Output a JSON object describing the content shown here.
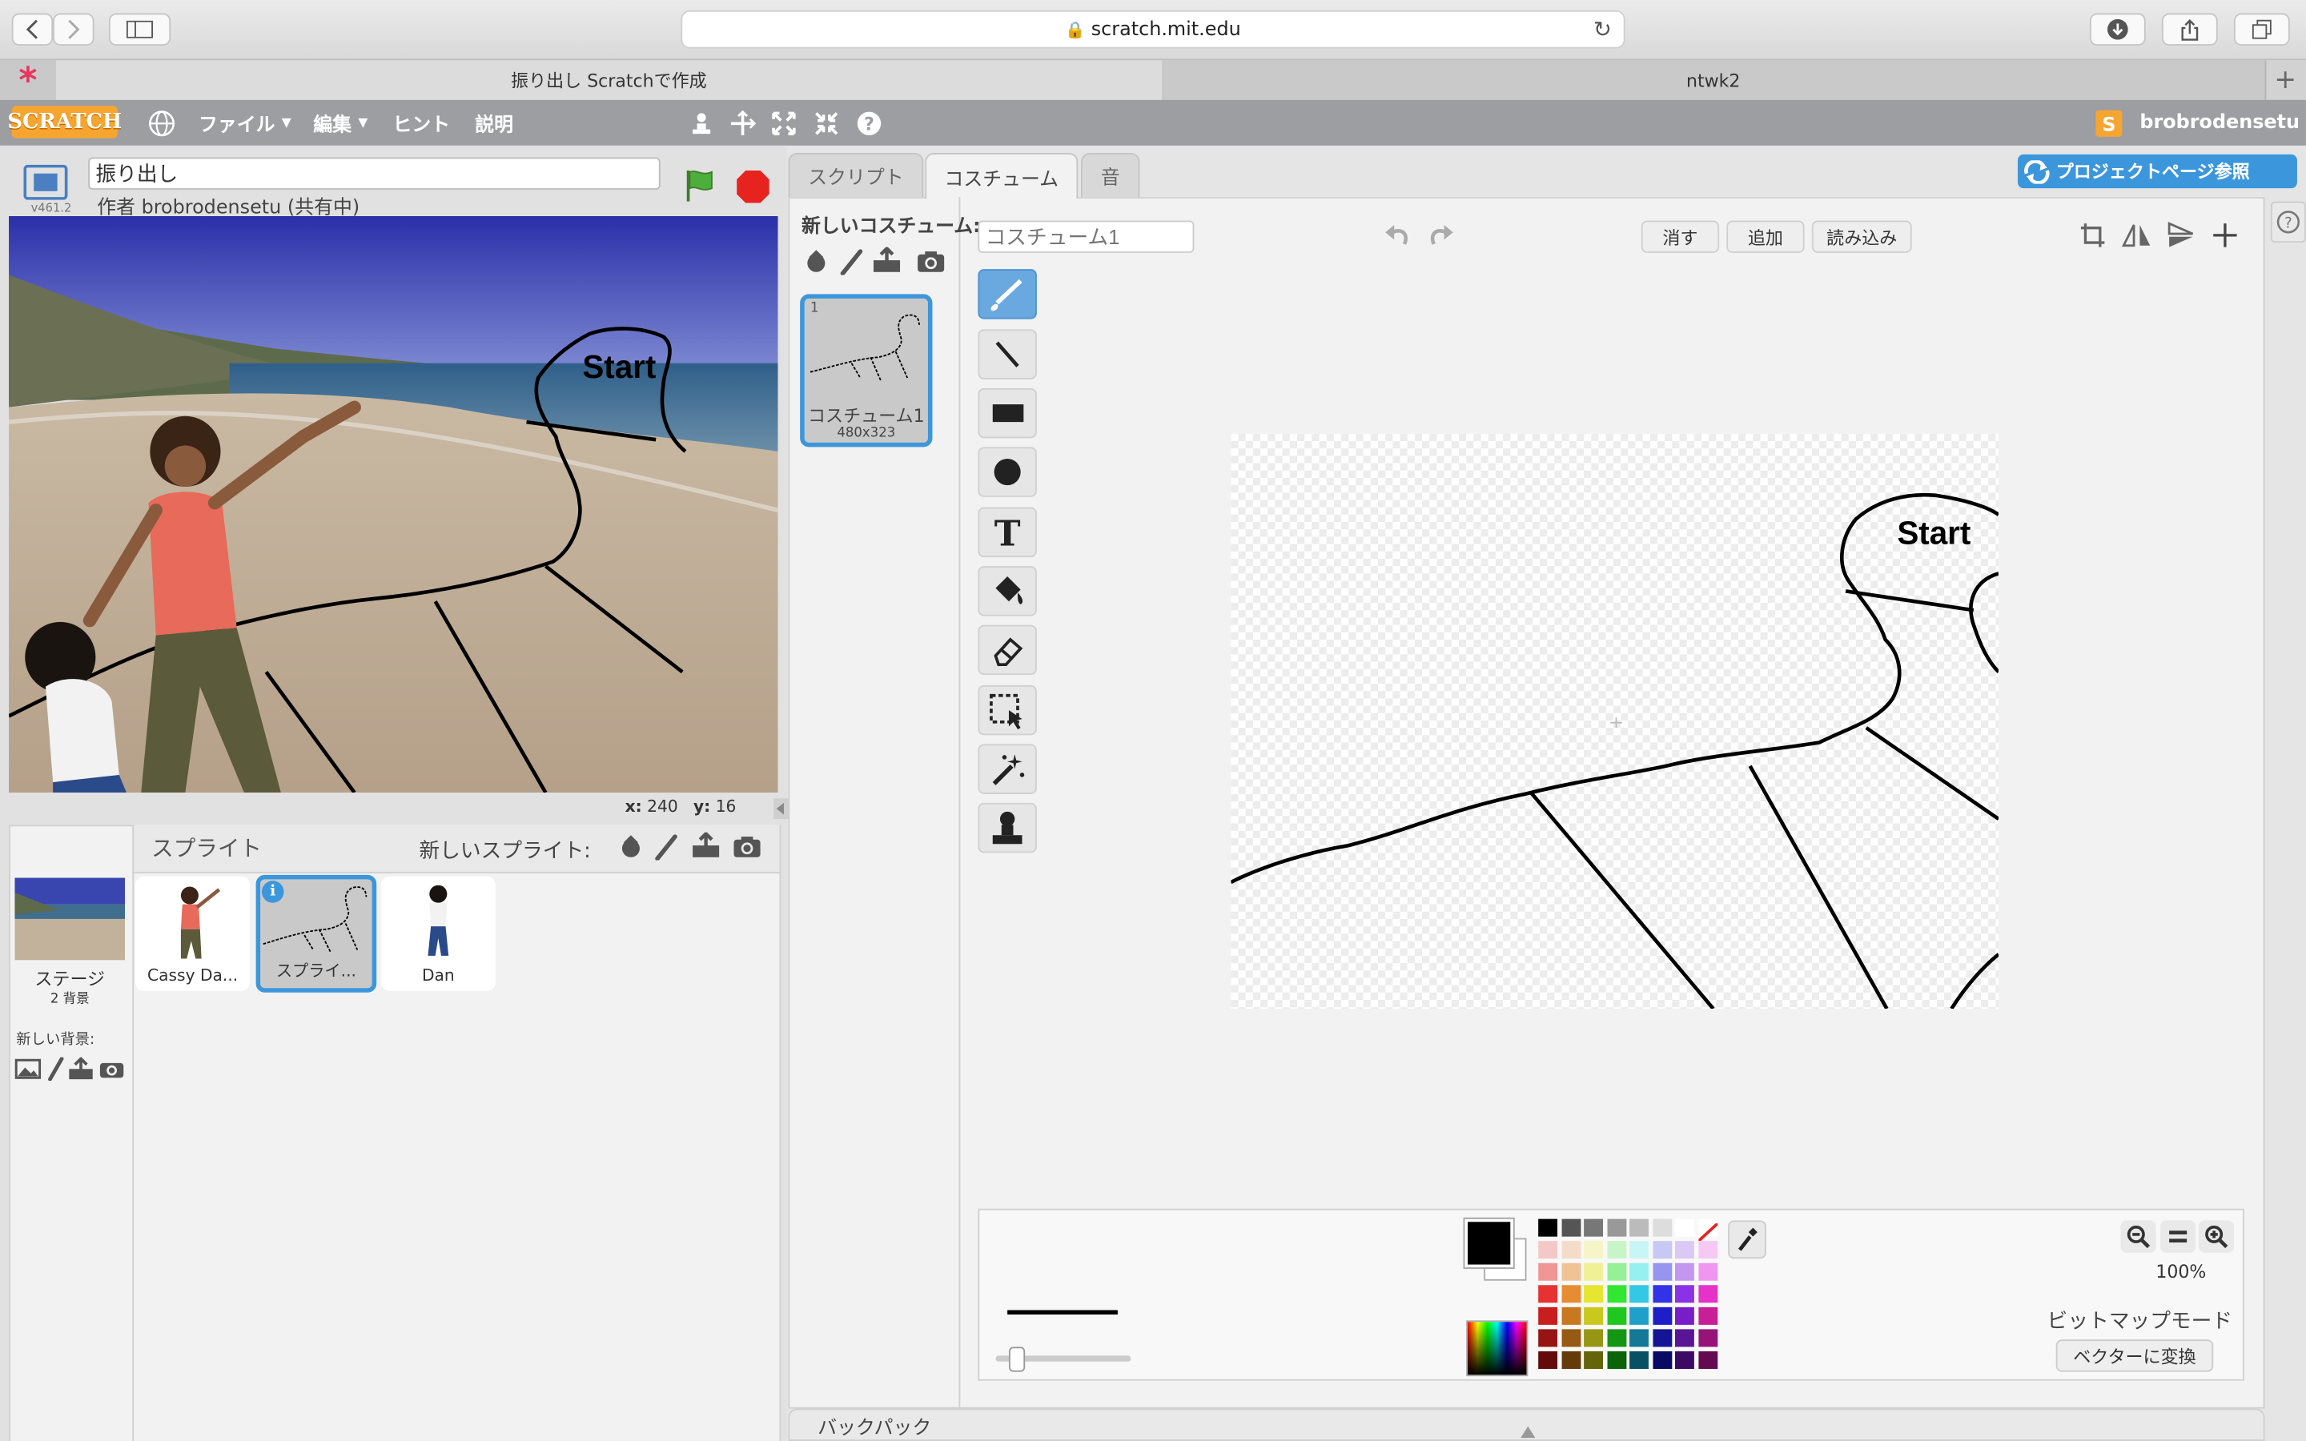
{
  "browser": {
    "url": "scratch.mit.edu",
    "tabs": [
      {
        "label": "振り出し Scratchで作成",
        "active": true
      },
      {
        "label": "ntwk2",
        "active": false
      }
    ]
  },
  "scratch_menu": {
    "logo": "SCRATCH",
    "items": [
      "ファイル",
      "編集",
      "ヒント",
      "説明"
    ],
    "user": "brobrodensetu"
  },
  "project": {
    "title": "振り出し",
    "author": "作者 brobrodensetu (共有中)",
    "version": "v461.2"
  },
  "stage": {
    "start_label": "Start",
    "coords": {
      "x_label": "x:",
      "x": "240",
      "y_label": "y:",
      "y": "16"
    }
  },
  "sprites_panel": {
    "title": "スプライト",
    "new_sprite_label": "新しいスプライト:",
    "stage_label": "ステージ",
    "stage_count": "2 背景",
    "new_backdrop_label": "新しい背景:",
    "sprites": [
      {
        "name": "Cassy Da..."
      },
      {
        "name": "スプライ...",
        "selected": true
      },
      {
        "name": "Dan"
      }
    ]
  },
  "editor": {
    "tabs": [
      "スクリプト",
      "コスチューム",
      "音"
    ],
    "active_tab": "コスチューム",
    "project_page_button": "プロジェクトページ参照",
    "new_costume_label": "新しいコスチューム:",
    "costume": {
      "index": "1",
      "name": "コスチューム1",
      "size": "480x323"
    },
    "costume_name_placeholder": "コスチューム1",
    "buttons": {
      "clear": "消す",
      "add": "追加",
      "import": "読み込み"
    },
    "zoom": "100%",
    "mode": "ビットマップモード",
    "convert_button": "ベクターに変換",
    "backpack": "バックパック",
    "tools": [
      "brush-tool",
      "line-tool",
      "rectangle-tool",
      "ellipse-tool",
      "text-tool",
      "fill-tool",
      "eraser-tool",
      "select-tool",
      "magic-select-tool",
      "stamp-tool"
    ],
    "active_tool": "brush-tool",
    "primary_color": "#000000",
    "secondary_color": "#ffffff",
    "palette": [
      [
        "#000000",
        "#555555",
        "#777777",
        "#999999",
        "#bbbbbb",
        "#dddddd",
        "#ffffff",
        "none"
      ],
      [
        "#f5c8c8",
        "#f5dcc8",
        "#f5f5c8",
        "#c8f5c8",
        "#c8f5f5",
        "#c8c8f5",
        "#dcc8f5",
        "#f5c8f5"
      ],
      [
        "#f09696",
        "#f0c396",
        "#f0f096",
        "#96f096",
        "#96f0f0",
        "#9696f0",
        "#c396f0",
        "#f096f0"
      ],
      [
        "#e63232",
        "#e68c32",
        "#e6e632",
        "#32e632",
        "#32c8e6",
        "#3232e6",
        "#8c32e6",
        "#e632c8"
      ],
      [
        "#c81e1e",
        "#c8781e",
        "#c8c81e",
        "#1ec81e",
        "#1ea0c8",
        "#1e1ec8",
        "#781ec8",
        "#c81e96"
      ],
      [
        "#961414",
        "#965a14",
        "#969614",
        "#149614",
        "#147896",
        "#141496",
        "#5a1496",
        "#961478"
      ],
      [
        "#640a0a",
        "#643c0a",
        "#64640a",
        "#0a640a",
        "#0a5064",
        "#0a0a64",
        "#3c0a64",
        "#640a50"
      ]
    ]
  }
}
